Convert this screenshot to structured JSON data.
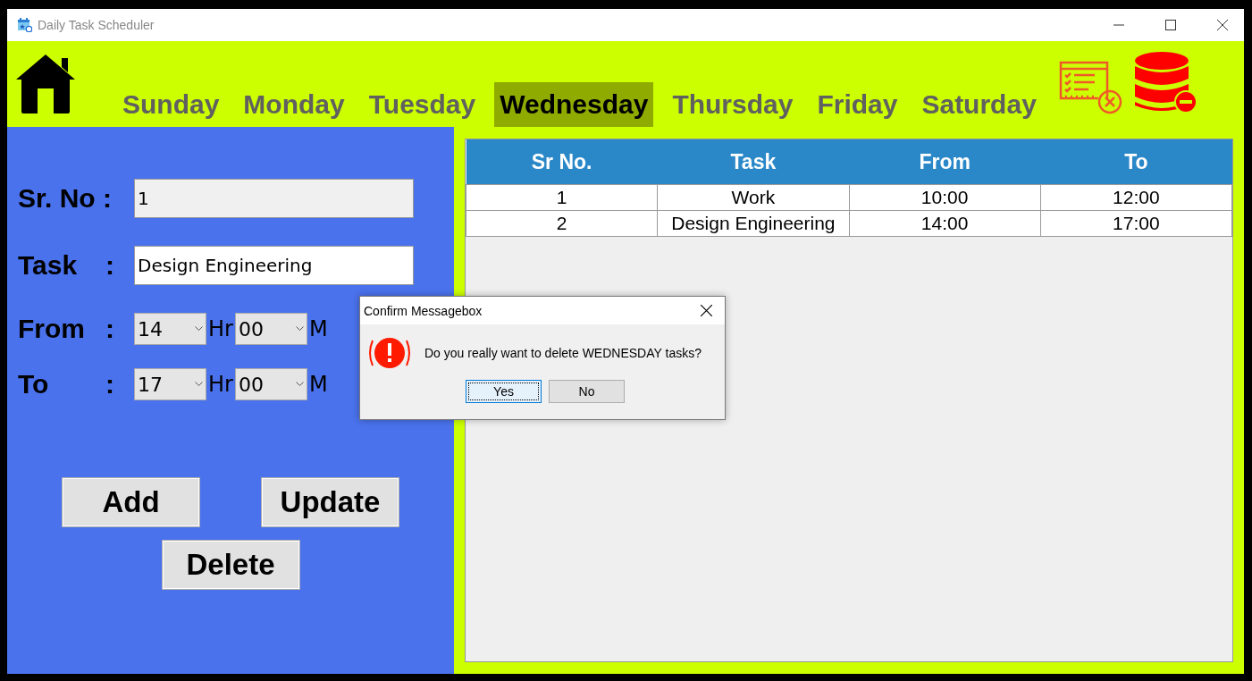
{
  "window": {
    "title": "Daily Task Scheduler"
  },
  "days": [
    {
      "label": "Sunday",
      "selected": false
    },
    {
      "label": "Monday",
      "selected": false
    },
    {
      "label": "Tuesday",
      "selected": false
    },
    {
      "label": "Wednesday",
      "selected": true
    },
    {
      "label": "Thursday",
      "selected": false
    },
    {
      "label": "Friday",
      "selected": false
    },
    {
      "label": "Saturday",
      "selected": false
    }
  ],
  "form": {
    "sr_no": {
      "label": "Sr. No :",
      "value": "1"
    },
    "task": {
      "label": "Task",
      "colon": ":",
      "value": "Design Engineering"
    },
    "from": {
      "label": "From",
      "colon": ":",
      "hour": "14",
      "hour_unit": "Hr",
      "minute": "00",
      "minute_unit": "M"
    },
    "to": {
      "label": "To",
      "colon": ":",
      "hour": "17",
      "hour_unit": "Hr",
      "minute": "00",
      "minute_unit": "M"
    },
    "buttons": [
      "Add",
      "Update",
      "Delete"
    ]
  },
  "table": {
    "columns": [
      "Sr No.",
      "Task",
      "From",
      "To"
    ],
    "rows": [
      [
        "1",
        "Work",
        "10:00",
        "12:00"
      ],
      [
        "2",
        "Design Engineering",
        "14:00",
        "17:00"
      ]
    ]
  },
  "dialog": {
    "title": "Confirm Messagebox",
    "message": "Do you really want to delete WEDNESDAY tasks?",
    "buttons": [
      {
        "label": "Yes",
        "selected": true
      },
      {
        "label": "No",
        "selected": false
      }
    ]
  }
}
